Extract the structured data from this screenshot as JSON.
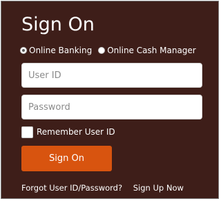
{
  "title": "Sign On",
  "account_type": {
    "options": [
      {
        "label": "Online Banking",
        "checked": true
      },
      {
        "label": "Online Cash Manager",
        "checked": false
      }
    ]
  },
  "user_id": {
    "value": "",
    "placeholder": "User ID"
  },
  "password": {
    "value": "",
    "placeholder": "Password"
  },
  "remember": {
    "label": "Remember User ID",
    "checked": false
  },
  "submit": {
    "label": "Sign On"
  },
  "links": {
    "forgot": "Forgot User ID/Password?",
    "signup": "Sign Up Now"
  },
  "colors": {
    "panel_background": "#3e1e19",
    "button_background": "#d8540f",
    "text": "#ffffff"
  }
}
